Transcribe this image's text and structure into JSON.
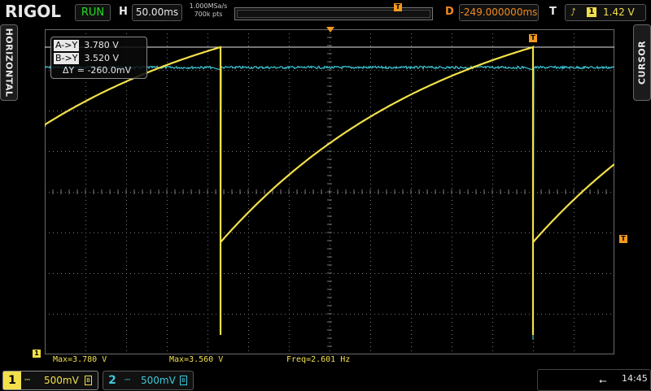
{
  "header": {
    "logo": "RIGOL",
    "run_status": "RUN",
    "h_label": "H",
    "timebase": "50.00ms",
    "sample_rate": "1.000MSa/s",
    "memory_depth": "700k pts",
    "trigger_pos_marker": "T",
    "d_label": "D",
    "delay": "-249.000000ms",
    "t_label": "T",
    "trigger_source": "1",
    "trigger_level": "1.42 V"
  },
  "side_tabs": {
    "left": "HORIZONTAL",
    "right": "CURSOR"
  },
  "cursor_readout": {
    "a_key": "A->Y",
    "a_value": "3.780 V",
    "b_key": "B->Y",
    "b_value": "3.520 V",
    "delta": "ΔY = -260.0mV"
  },
  "markers": {
    "trigger_top": "T",
    "trigger_level": "T",
    "ch1_ground": "1"
  },
  "measurements": {
    "m1": "Max=3.780 V",
    "m2": "Max=3.560 V",
    "m3": "Freq=2.601 Hz"
  },
  "channels": [
    {
      "number": "1",
      "scale": "500mV",
      "color": "#f2e04a"
    },
    {
      "number": "2",
      "scale": "500mV",
      "color": "#3cc8d8"
    }
  ],
  "status": {
    "usb_icon": "usb-icon",
    "time": "14:45"
  },
  "colors": {
    "ch1": "#f2e04a",
    "ch2": "#3cc8d8",
    "accent": "#f39a1d",
    "run": "#22dd22"
  }
}
